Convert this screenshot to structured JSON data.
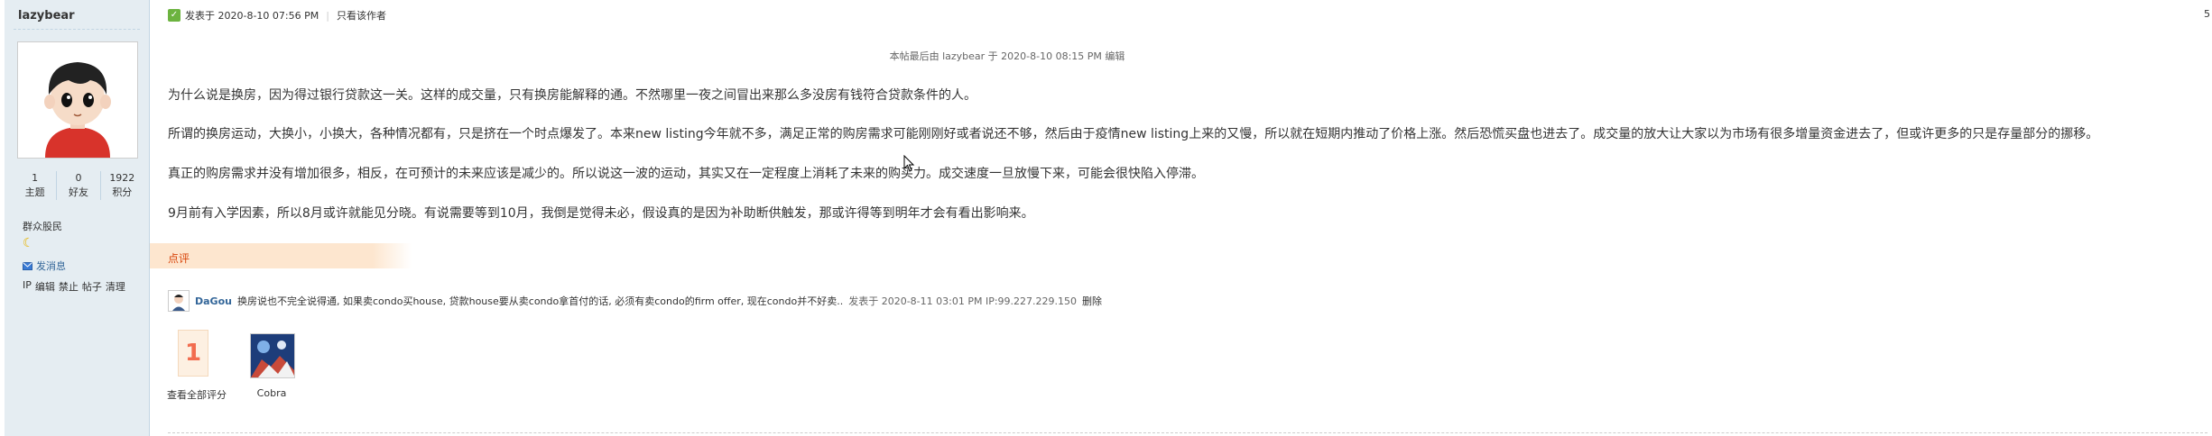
{
  "user": {
    "name": "lazybear",
    "stats": [
      {
        "value": "1",
        "label": "主题"
      },
      {
        "value": "0",
        "label": "好友"
      },
      {
        "value": "1922",
        "label": "积分"
      }
    ],
    "rank": "群众股民",
    "send_message": "发消息",
    "admin_links": [
      "IP",
      "编辑",
      "禁止",
      "帖子",
      "清理"
    ]
  },
  "post": {
    "posted": "发表于 2020-8-10 07:56 PM",
    "author_only": "只看该作者",
    "right_mark": "5",
    "edited_note": "本帖最后由 lazybear 于 2020-8-10 08:15 PM 编辑",
    "paragraphs": [
      "为什么说是换房，因为得过银行贷款这一关。这样的成交量，只有换房能解释的通。不然哪里一夜之间冒出来那么多没房有钱符合贷款条件的人。",
      "所谓的换房运动，大换小，小换大，各种情况都有，只是挤在一个时点爆发了。本来new listing今年就不多，满足正常的购房需求可能刚刚好或者说还不够，然后由于疫情new listing上来的又慢，所以就在短期内推动了价格上涨。然后恐慌买盘也进去了。成交量的放大让大家以为市场有很多增量资金进去了，但或许更多的只是存量部分的挪移。",
      "真正的购房需求并没有增加很多，相反，在可预计的未来应该是减少的。所以说这一波的运动，其实又在一定程度上消耗了未来的购买力。成交速度一旦放慢下来，可能会很快陷入停滞。",
      "9月前有入学因素，所以8月或许就能见分晓。有说需要等到10月，我倒是觉得未必，假设真的是因为补助断供触发，那或许得等到明年才会有看出影响来。"
    ],
    "dianping_label": "点评",
    "comment": {
      "author": "DaGou",
      "text": "换房说也不完全说得通, 如果卖condo买house, 贷款house要从卖condo拿首付的话, 必须有卖condo的firm offer, 现在condo并不好卖..",
      "meta": "发表于 2020-8-11 03:01 PM IP:99.227.229.150",
      "delete": "删除"
    },
    "rating": {
      "count": "1",
      "view_all": "查看全部评分",
      "rater": "Cobra"
    }
  }
}
